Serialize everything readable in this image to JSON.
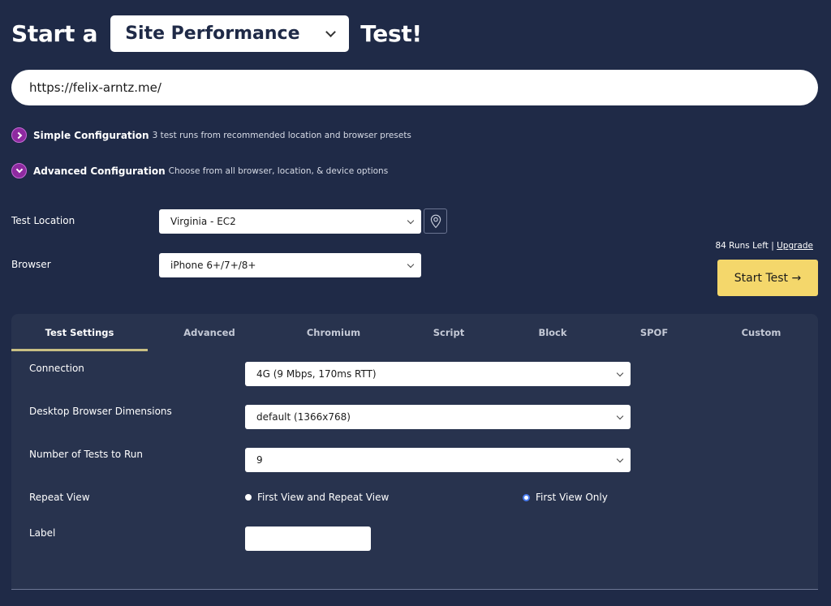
{
  "header": {
    "prefix": "Start a",
    "test_type": "Site Performance",
    "suffix": "Test!"
  },
  "url_input": {
    "value": "https://felix-arntz.me/"
  },
  "config": {
    "simple": {
      "title": "Simple Configuration",
      "description": "3 test runs from recommended location and browser presets",
      "icon": "chevron-right-circle-icon"
    },
    "advanced": {
      "title": "Advanced Configuration",
      "description": "Choose from all browser, location, & device options",
      "icon": "chevron-down-circle-icon"
    }
  },
  "location": {
    "label": "Test Location",
    "value": "Virginia - EC2",
    "map_icon": "map-pin-icon"
  },
  "browser": {
    "label": "Browser",
    "value": "iPhone 6+/7+/8+"
  },
  "runs": {
    "text": "84 Runs Left |",
    "upgrade_label": "Upgrade"
  },
  "start_button": {
    "label": "Start Test →"
  },
  "tabs": [
    {
      "label": "Test Settings",
      "active": true
    },
    {
      "label": "Advanced",
      "active": false
    },
    {
      "label": "Chromium",
      "active": false
    },
    {
      "label": "Script",
      "active": false
    },
    {
      "label": "Block",
      "active": false
    },
    {
      "label": "SPOF",
      "active": false
    },
    {
      "label": "Custom",
      "active": false
    }
  ],
  "settings": {
    "connection": {
      "label": "Connection",
      "value": "4G (9 Mbps, 170ms RTT)"
    },
    "dimensions": {
      "label": "Desktop Browser Dimensions",
      "value": "default (1366x768)"
    },
    "num_tests": {
      "label": "Number of Tests to Run",
      "value": "9"
    },
    "repeat_view": {
      "label": "Repeat View",
      "options": [
        {
          "label": "First View and Repeat View",
          "checked": false
        },
        {
          "label": "First View Only",
          "checked": true
        }
      ]
    },
    "label_field": {
      "label": "Label",
      "value": ""
    }
  },
  "colors": {
    "background": "#1f2a47",
    "panel": "#28334e",
    "accent_purple": "#8e2aa0",
    "start_button": "#f4d76b",
    "tab_underline": "#c8bf83",
    "radio_checked": "#4a7cf0"
  }
}
